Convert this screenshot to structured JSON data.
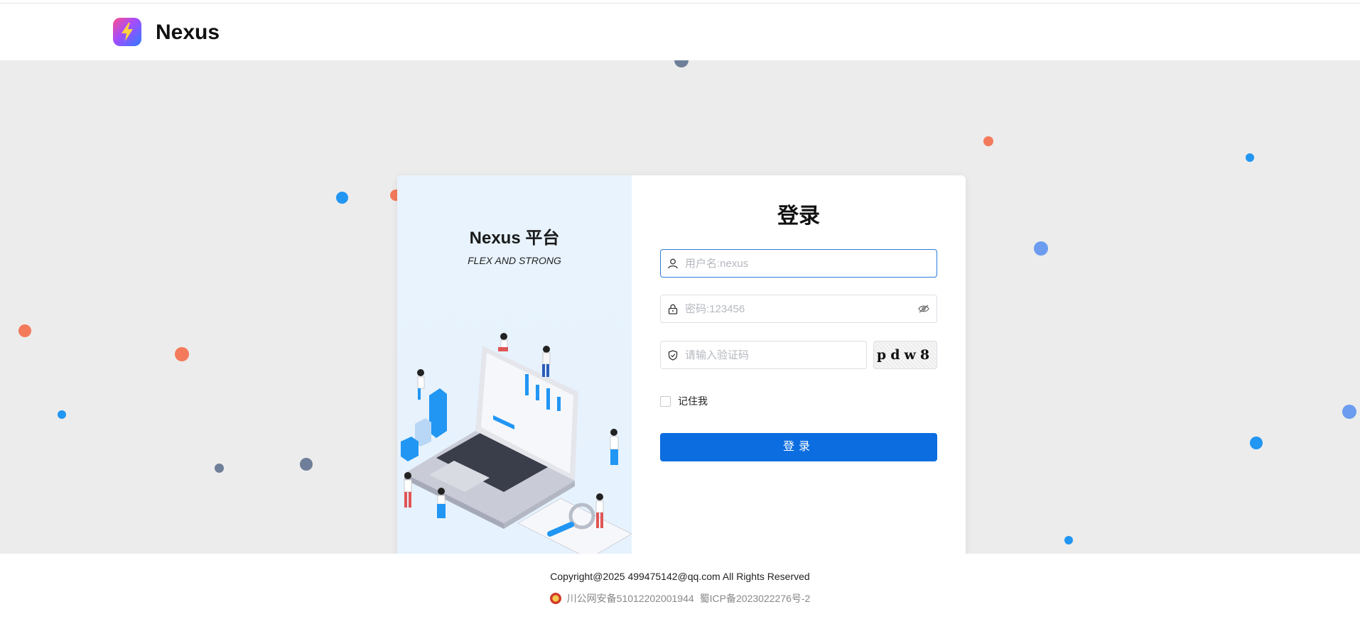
{
  "header": {
    "brand": "Nexus",
    "logo_icon": "lightning-icon"
  },
  "left_panel": {
    "title": "Nexus 平台",
    "subtitle": "FLEX AND STRONG"
  },
  "login": {
    "title": "登录",
    "username_placeholder": "用户名:nexus",
    "password_placeholder": "密码:123456",
    "captcha_placeholder": "请输入验证码",
    "captcha_text": "pdw8",
    "remember_label": "记住我",
    "submit_label": "登录"
  },
  "footer": {
    "copyright": "Copyright@2025 499475142@qq.com All Rights Reserved",
    "police_record": "川公网安备51012202001944",
    "icp_record": "蜀ICP备2023022276号-2"
  },
  "colors": {
    "primary": "#0c6de0",
    "background": "#ececec",
    "dot_orange": "#f47a5c",
    "dot_blue": "#2196f3",
    "dot_gray": "#6f7f99",
    "dot_yellow": "#ffc25c"
  }
}
